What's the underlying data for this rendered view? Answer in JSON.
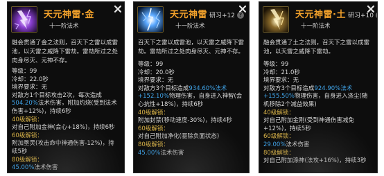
{
  "cards": [
    {
      "title": "天元神雷·金",
      "extra": "",
      "subtitle": "十一阶法术",
      "desc": "融会贯通了金之法则，召天下之雷以成雷池，以天雷之威降下雷劫。雷劫所过之处肉身尽灭、元神不存。",
      "level": "等级：99",
      "cooldown": "冷却：22.0秒",
      "requirement": "境界要求：无",
      "effect_pre": "对敌方1个目标攻击2次，每次造成",
      "effect_pct": "504.20%",
      "effect_post": "法术伤害，附加灼烧(受到法术伤害+12%)，持续6秒",
      "unlocks": [
        {
          "label": "40级解锁：",
          "text": "对自己附加金神(会心+18%)，持续6秒",
          "hl": "",
          "tail": ""
        },
        {
          "label": "60级解锁：",
          "text": "附加垦灵(攻击命中神通伤害-12%)，持续5秒",
          "hl": "",
          "tail": ""
        },
        {
          "label": "80级解锁：",
          "text": "",
          "hl": "45.00%",
          "tail": "法术伤害"
        }
      ]
    },
    {
      "title": "天元神雷",
      "extra": "研习+12",
      "subtitle": "十一阶法术",
      "desc": "召天下之雷以成雷池，以天雷之威降下雷劫。雷劫所过之处肉身尽灭、元神不存。",
      "level": "等级：99",
      "cooldown": "冷却：20.0秒",
      "requirement": "境界要求：无",
      "effect_pre": "对敌方3个目标造成",
      "effect_pct": "934.60%法术+152.10%",
      "effect_post": "物理伤害，自身进入神智(会心抗性+18%)，持续6秒",
      "unlocks": [
        {
          "label": "40级解锁：",
          "text": "附加封禁(移动速度-30%)，持续4秒",
          "hl": "",
          "tail": ""
        },
        {
          "label": "60级解锁：",
          "text": "对自己附加净化(驱除负面状态)",
          "hl": "",
          "tail": ""
        },
        {
          "label": "80级解锁：",
          "text": "",
          "hl": "45.00%",
          "tail": "法术伤害"
        }
      ]
    },
    {
      "title": "天元神雷·土",
      "extra": "研习+10",
      "subtitle": "十一阶法术",
      "desc": "融会贯通了土之法则，召天下之雷以成雷池，以天雷之威降下雷劫。",
      "level": "等级：99",
      "cooldown": "冷却：21.0秒",
      "requirement": "境界要求：无",
      "effect_pre": "对敌方3个目标造成",
      "effect_pct": "924.90%法术+155.50%",
      "effect_post": "物理伤害，自身进入涤尘(随机移除2个减益效果)",
      "unlocks": [
        {
          "label": "40级解锁：",
          "text": "对自己附加金刚(受到神通伤害减免+12%)，持续5秒",
          "hl": "",
          "tail": ""
        },
        {
          "label": "60级解锁：",
          "text": "",
          "hl": "29.00%",
          "tail": "法术伤害"
        },
        {
          "label": "80级解锁：",
          "text": "对自己附加涤神(法攻+16%)，持续3秒",
          "hl": "",
          "tail": ""
        }
      ]
    }
  ],
  "colors": {
    "title": "#f2a12b",
    "highlight": "#3fa3e8",
    "unlock": "#d8b248"
  },
  "icons": {
    "skill": "lightning-skill-icon",
    "close": "close-icon",
    "help": "help-icon"
  }
}
